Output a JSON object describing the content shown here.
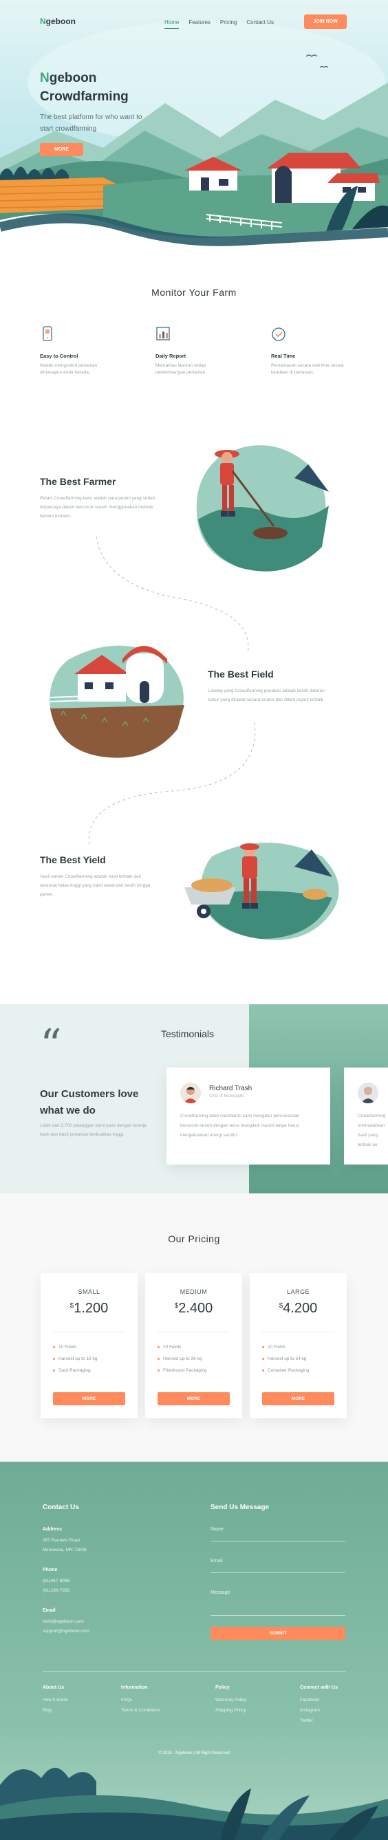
{
  "brand": {
    "first_letter": "N",
    "rest": "geboon"
  },
  "nav": {
    "links": [
      "Home",
      "Features",
      "Pricing",
      "Contact Us"
    ],
    "cta": "JOIN NOW"
  },
  "hero": {
    "title_first": "N",
    "title_line1_rest": "geboon",
    "title_line2": "Crowdfarming",
    "subtitle": "The best platform for who want to start crowdfarming",
    "button": "MORE"
  },
  "monitor": {
    "title": "Monitor Your Farm",
    "features": [
      {
        "icon": "phone-icon",
        "title": "Easy to Control",
        "desc": "Mudah mengontrol pertanian dimanapun Anda berada."
      },
      {
        "icon": "chart-icon",
        "title": "Daily Report",
        "desc": "Memantau laporan setiap perkembangan pertanian."
      },
      {
        "icon": "clock-check-icon",
        "title": "Real Time",
        "desc": "Pemantauan secara real time sesuai keadaan di pertanian."
      }
    ]
  },
  "rows": [
    {
      "title": "The Best Farmer",
      "desc": "Petani Crowdfarming kami adalah para petani yang sudah terpercaya dalam bercocok tanam menggunakan metode bertani modern."
    },
    {
      "title": "The Best Field",
      "desc": "Ladang yang Crowdfarming gunakan adalah tanah dataran subur yang dirawat secara teratur dan diberi pupuk terbaik."
    },
    {
      "title": "The Best Yield",
      "desc": "Hasil panen Crowdfarming adalah hasil terbaik dari tanaman kelas tinggi yang kami rawat dari benih hingga panen."
    }
  ],
  "testimonials": {
    "title": "Testimonials",
    "heading": "Our Customers love what we do",
    "sub": "Lebih dari 2.700 pelanggan kami puas dengan kinerja kami dan hasil pertanian berkualitas tinggi.",
    "cards": [
      {
        "name": "Richard Trash",
        "role": "CEO of Mumoaphs",
        "text": "Crowdfarming telah membantu kami mengatur perencanaan bercocok tanam dengan terus mengikuti musim tanpa harus mengeluarkan energi sendiri."
      },
      {
        "name": "",
        "role": "",
        "text": "Crowdfarming memudahkan hasil yang terbaik pe"
      }
    ]
  },
  "pricing": {
    "title": "Our Pricing",
    "plans": [
      {
        "name": "SMALL",
        "currency": "$",
        "price": "1.200",
        "features": [
          "10 Fields",
          "Harvest up to 18 kg",
          "Sack Packaging"
        ],
        "button": "MORE"
      },
      {
        "name": "MEDIUM",
        "currency": "$",
        "price": "2.400",
        "features": [
          "20 Fields",
          "Harvest up to 36 kg",
          "Fiberboard Packaging"
        ],
        "button": "MORE"
      },
      {
        "name": "LARGE",
        "currency": "$",
        "price": "4.200",
        "features": [
          "10 Fields",
          "Harvest up to 54 kg",
          "Container Packaging"
        ],
        "button": "MORE"
      }
    ]
  },
  "footer": {
    "contact_title": "Contact Us",
    "address_label": "Address",
    "address_lines": [
      "267 Runnels Road",
      "Minnesota, MN 73008"
    ],
    "phone_label": "Phone",
    "phone_lines": [
      "(61)067-8088",
      "(61)190-7058"
    ],
    "email_label": "Email",
    "email_lines": [
      "hello@ngeboon.com",
      "support@ngeboon.com"
    ],
    "form_title": "Send Us Message",
    "form_name": "Name",
    "form_email": "Email",
    "form_message": "Message",
    "submit": "SUBMIT",
    "columns": [
      {
        "head": "About Us",
        "items": [
          "How it works",
          "Blog"
        ]
      },
      {
        "head": "Information",
        "items": [
          "FAQs",
          "Terms & Conditions"
        ]
      },
      {
        "head": "Policy",
        "items": [
          "Warranty Policy",
          "Shipping Policy"
        ]
      },
      {
        "head": "Connect with Us",
        "items": [
          "Facebook",
          "Instagram",
          "Twitter"
        ]
      }
    ],
    "copyright": "© 2018 - Ngeboon | All Right Reserved"
  },
  "colors": {
    "accent": "#ff8a5b",
    "green": "#3aa77e",
    "dark": "#2f3a3e",
    "muted": "#9aa6aa"
  }
}
